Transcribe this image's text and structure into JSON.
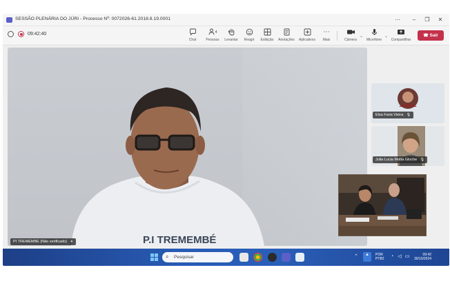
{
  "window": {
    "title": "SESSÃO PLENÁRIA DO JÚRI - Processo Nº: 0072026-61.2018.8.19.0001"
  },
  "toolbar": {
    "timer": "09:42:40",
    "tools": [
      {
        "label": "Chat",
        "icon": "chat-icon"
      },
      {
        "label": "Pessoas",
        "icon": "people-icon"
      },
      {
        "label": "Levantar",
        "icon": "raise-hand-icon"
      },
      {
        "label": "Reagir",
        "icon": "react-icon"
      },
      {
        "label": "Exibição",
        "icon": "view-icon"
      },
      {
        "label": "Anotações",
        "icon": "notes-icon"
      },
      {
        "label": "Aplicativos",
        "icon": "apps-icon"
      },
      {
        "label": "Mais",
        "icon": "more-icon"
      }
    ],
    "people_count": "4",
    "camera_label": "Câmera",
    "mic_label": "Microfone",
    "share_label": "Compartilhar",
    "leave_label": "Sair"
  },
  "participants": {
    "main_name": "PI TREMEMBE (Não verificado)",
    "shirt_text": "P.I TREMEMBÉ",
    "tiles": [
      {
        "name": "Elsa Faria Vieira"
      },
      {
        "name": "Julia Lucia Motta Gloche"
      }
    ]
  },
  "taskbar": {
    "search_placeholder": "Pesquisar",
    "lang": "POR",
    "layout": "PTB2",
    "time": "09:42",
    "date": "30/10/2024"
  },
  "colors": {
    "leave": "#c4314b",
    "teams_accent": "#5b5fc7",
    "taskbar": "#285bb5"
  }
}
